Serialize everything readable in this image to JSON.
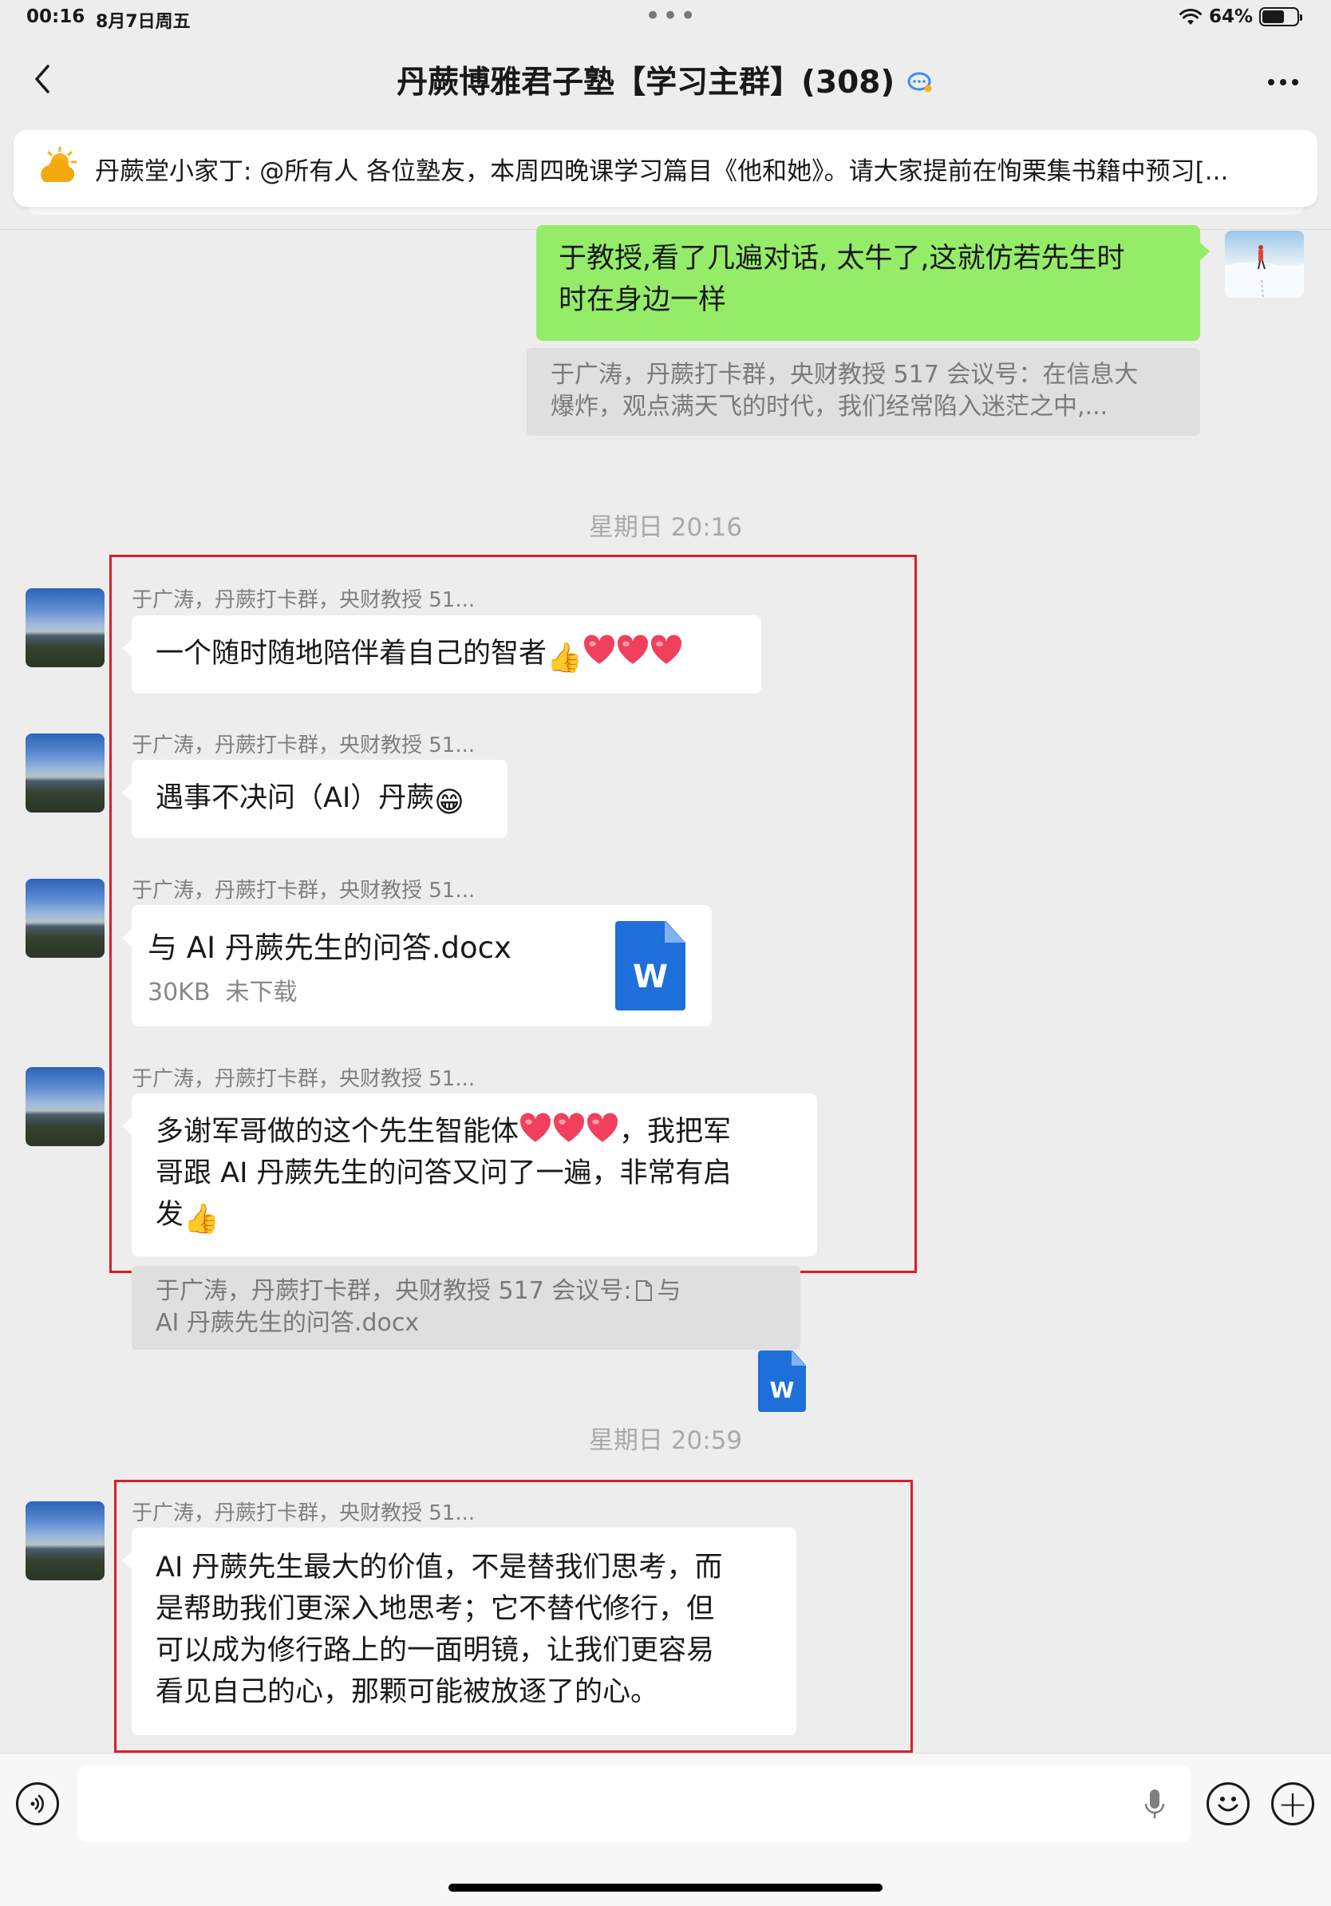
{
  "status_bar": {
    "time": "00:16",
    "date": "8月7日周五",
    "dots": "•••",
    "battery_pct": "64%",
    "battery_level": 0.64
  },
  "nav": {
    "title": "丹蕨博雅君子塾【学习主群】(308)",
    "back_icon": "chevron-left-icon",
    "more_icon": "more-dots-icon"
  },
  "notice": {
    "icon": "announcement-sun-icon",
    "text": "丹蕨堂小家丁: @所有人 各位塾友，本周四晚课学习篇目《他和她》。请大家提前在恂栗集书籍中预习[..."
  },
  "messages": {
    "self_msg": "于教授,看了几遍对话, 太牛了,这就仿若先生时时在身边一样",
    "self_msg_line1": "于教授,看了几遍对话, 太牛了,这就仿若先生时",
    "self_msg_line2": "时在身边一样",
    "self_quote_line1": "于广涛，丹蕨打卡群，央财教授 517 会议号：在信息大",
    "self_quote_line2": "爆炸，观点满天飞的时代，我们经常陷入迷茫之中,...",
    "time1": "星期日 20:16",
    "sender": "于广涛，丹蕨打卡群，央财教授 51...",
    "msg1": "一个随时随地陪伴着自己的智者",
    "msg2": "遇事不决问（AI）丹蕨",
    "file_name": "与 AI 丹蕨先生的问答.docx",
    "file_meta": "30KB  未下载",
    "file_icon_letter": "W",
    "msg4_line1": "多谢军哥做的这个先生智能体",
    "msg4_line1b": "，我把军",
    "msg4_line2": "哥跟 AI 丹蕨先生的问答又问了一遍，非常有启",
    "msg4_line3": "发",
    "quote2_line1": "于广涛，丹蕨打卡群，央财教授 517 会议号:",
    "quote2_line1b": "与",
    "quote2_line2": "AI 丹蕨先生的问答.docx",
    "time2": "星期日 20:59",
    "msg5_lines": [
      "AI 丹蕨先生最大的价值，不是替我们思考，而",
      "是帮助我们更深入地思考；它不替代修行，但",
      "可以成为修行路上的一面明镜，让我们更容易",
      "看见自己的心，那颗可能被放逐了的心。"
    ]
  },
  "input_bar": {
    "voice_icon": "voice-icon",
    "mic_icon": "microphone-icon",
    "emoji_icon": "emoji-icon",
    "plus_icon": "plus-icon",
    "plus_glyph": "+"
  },
  "colors": {
    "background": "#ededed",
    "self_bubble": "#95ec69",
    "highlight_box": "#d7202a",
    "word_blue": "#1e6fd9"
  }
}
